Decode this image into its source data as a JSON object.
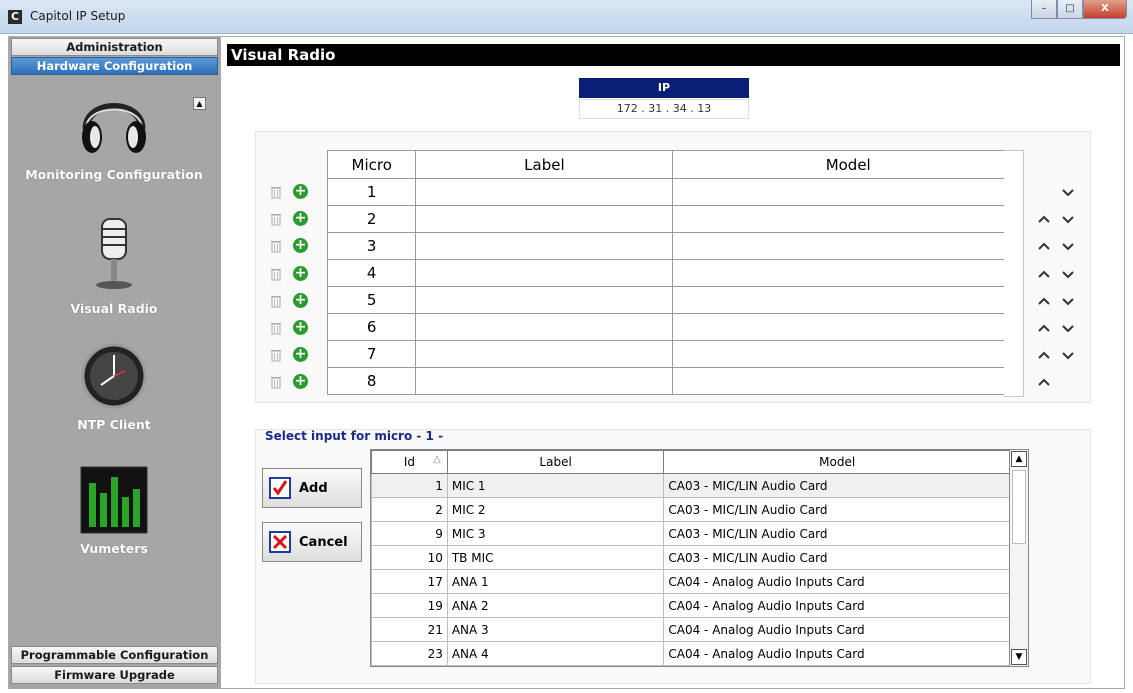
{
  "window": {
    "title": "Capitol IP Setup",
    "icon_letter": "C",
    "minimize": "–",
    "maximize": "□",
    "close": "X"
  },
  "sidebar": {
    "top_tabs": [
      "Administration",
      "Hardware Configuration"
    ],
    "bottom_tabs": [
      "Programmable Configuration",
      "Firmware Upgrade"
    ],
    "items": [
      {
        "label": "Monitoring Configuration",
        "icon": "headphones-icon"
      },
      {
        "label": "Visual Radio",
        "icon": "microphone-icon"
      },
      {
        "label": "NTP Client",
        "icon": "clock-icon"
      },
      {
        "label": "Vumeters",
        "icon": "vumeter-icon"
      }
    ]
  },
  "main": {
    "title": "Visual Radio",
    "ip_label": "IP",
    "ip_value": "172 . 31 . 34 . 13",
    "micro_grid": {
      "headers": [
        "Micro",
        "Label",
        "Model"
      ],
      "rows": [
        "1",
        "2",
        "3",
        "4",
        "5",
        "6",
        "7",
        "8"
      ]
    },
    "select_title": "Select input for micro - 1 -",
    "buttons": {
      "add": "Add",
      "cancel": "Cancel"
    },
    "input_grid": {
      "headers": [
        "Id",
        "Label",
        "Model"
      ],
      "sort_indicator": "△",
      "rows": [
        {
          "id": "1",
          "label": "MIC 1",
          "model": "CA03 - MIC/LIN Audio Card"
        },
        {
          "id": "2",
          "label": "MIC 2",
          "model": "CA03 - MIC/LIN Audio Card"
        },
        {
          "id": "9",
          "label": "MIC 3",
          "model": "CA03 - MIC/LIN Audio Card"
        },
        {
          "id": "10",
          "label": "TB MIC",
          "model": "CA03 - MIC/LIN Audio Card"
        },
        {
          "id": "17",
          "label": "ANA 1",
          "model": "CA04 - Analog Audio Inputs Card"
        },
        {
          "id": "19",
          "label": "ANA 2",
          "model": "CA04 - Analog Audio Inputs Card"
        },
        {
          "id": "21",
          "label": "ANA 3",
          "model": "CA04 - Analog Audio Inputs Card"
        },
        {
          "id": "23",
          "label": "ANA 4",
          "model": "CA04 - Analog Audio Inputs Card"
        }
      ]
    }
  },
  "colors": {
    "sidebar_bg": "#a6a6a6",
    "active_tab": "#2f6fb8",
    "ip_header": "#0a1e78",
    "plus_green": "#2d9b32",
    "select_title": "#1a2a8a"
  }
}
